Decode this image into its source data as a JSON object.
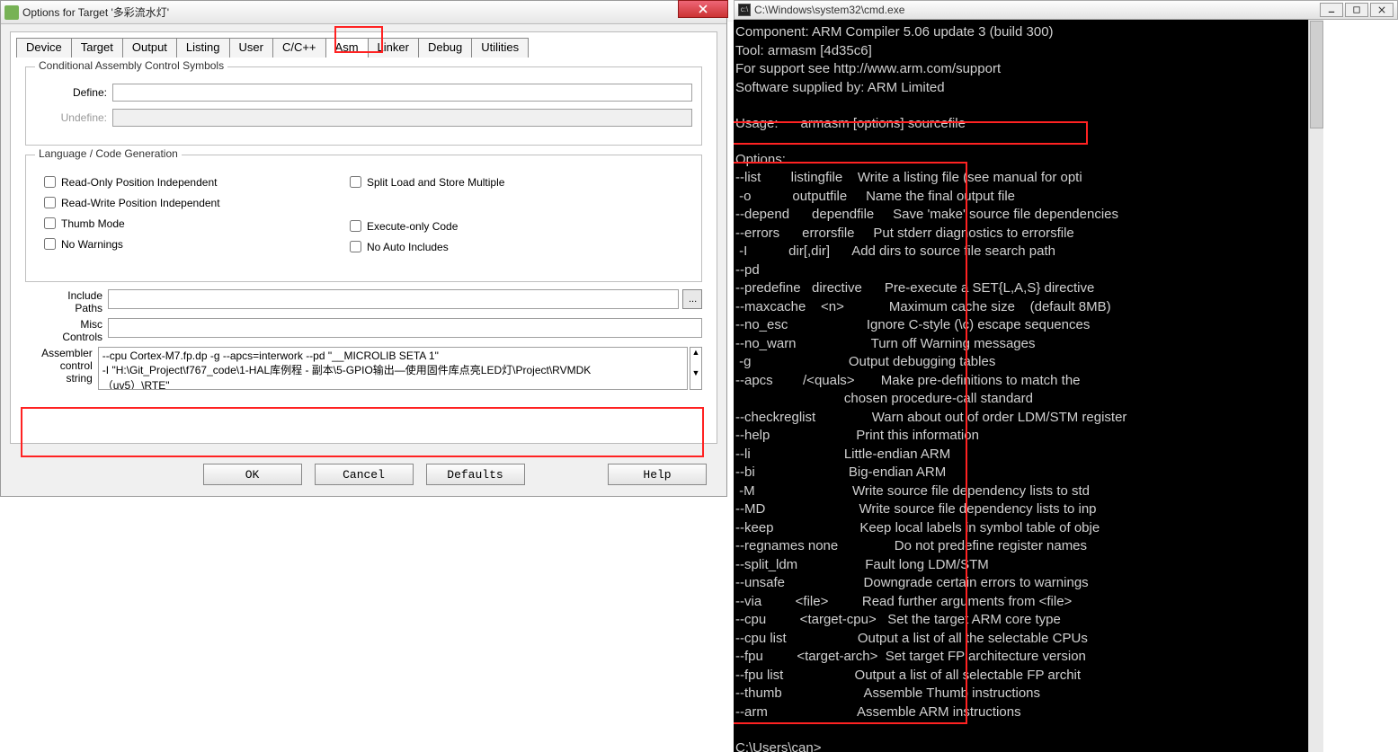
{
  "dialog": {
    "title": "Options for Target '多彩流水灯'",
    "tabs": [
      "Device",
      "Target",
      "Output",
      "Listing",
      "User",
      "C/C++",
      "Asm",
      "Linker",
      "Debug",
      "Utilities"
    ],
    "activeTab": "Asm",
    "group1": {
      "legend": "Conditional Assembly Control Symbols",
      "define_lbl": "Define:",
      "undefine_lbl": "Undefine:"
    },
    "group2": {
      "legend": "Language / Code Generation",
      "chk_ropi": "Read-Only Position Independent",
      "chk_rwpi": "Read-Write Position Independent",
      "chk_thumb": "Thumb Mode",
      "chk_nowarn": "No Warnings",
      "chk_split": "Split Load and Store Multiple",
      "chk_execonly": "Execute-only Code",
      "chk_noauto": "No Auto Includes"
    },
    "include_lbl": "Include\nPaths",
    "misc_lbl": "Misc\nControls",
    "asm_lbl": "Assembler\ncontrol\nstring",
    "asm_string": "--cpu Cortex-M7.fp.dp -g --apcs=interwork --pd \"__MICROLIB SETA 1\"\n-I \"H:\\Git_Project\\f767_code\\1-HAL库例程 - 副本\\5-GPIO输出—使用固件库点亮LED灯\\Project\\RVMDK\n（uv5）\\RTE\"",
    "btn_ok": "OK",
    "btn_cancel": "Cancel",
    "btn_defaults": "Defaults",
    "btn_help": "Help"
  },
  "cmd": {
    "title": "C:\\Windows\\system32\\cmd.exe",
    "header": "Component: ARM Compiler 5.06 update 3 (build 300)\nTool: armasm [4d35c6]\nFor support see http://www.arm.com/support\nSoftware supplied by: ARM Limited",
    "usage": "Usage:      armasm [options] sourcefile",
    "options_hdr": "Options:",
    "opts": [
      [
        "--list",
        "listingfile",
        "Write a listing file (see manual for opti"
      ],
      [
        " -o",
        "outputfile",
        "Name the final output file"
      ],
      [
        "--depend",
        "dependfile",
        "Save 'make' source file dependencies"
      ],
      [
        "--errors",
        "errorsfile",
        "Put stderr diagnostics to errorsfile"
      ],
      [
        " -I",
        "dir[,dir]",
        "Add dirs to source file search path"
      ],
      [
        "--pd",
        "",
        ""
      ],
      [
        "--predefine",
        "directive",
        "Pre-execute a SET{L,A,S} directive"
      ],
      [
        "--maxcache",
        "<n>",
        "Maximum cache size    (default 8MB)"
      ],
      [
        "--no_esc",
        "",
        "Ignore C-style (\\c) escape sequences"
      ],
      [
        "--no_warn",
        "",
        "Turn off Warning messages"
      ],
      [
        " -g",
        "",
        "Output debugging tables"
      ],
      [
        "--apcs",
        "/<quals>",
        "Make pre-definitions to match the"
      ],
      [
        "",
        "",
        "chosen procedure-call standard"
      ],
      [
        "--checkreglist",
        "",
        "Warn about out of order LDM/STM register"
      ],
      [
        "--help",
        "",
        "Print this information"
      ],
      [
        "--li",
        "",
        "Little-endian ARM"
      ],
      [
        "--bi",
        "",
        "Big-endian ARM"
      ],
      [
        " -M",
        "",
        "Write source file dependency lists to std"
      ],
      [
        "--MD",
        "",
        "Write source file dependency lists to inp"
      ],
      [
        "--keep",
        "",
        "Keep local labels in symbol table of obje"
      ],
      [
        "--regnames none",
        "",
        "Do not predefine register names"
      ],
      [
        "--split_ldm",
        "",
        "Fault long LDM/STM"
      ],
      [
        "--unsafe",
        "",
        "Downgrade certain errors to warnings"
      ],
      [
        "--via",
        "<file>",
        "Read further arguments from <file>"
      ],
      [
        "--cpu",
        "<target-cpu>",
        "Set the target ARM core type"
      ],
      [
        "--cpu list",
        "",
        "Output a list of all the selectable CPUs"
      ],
      [
        "--fpu",
        "<target-arch>",
        "Set target FP architecture version"
      ],
      [
        "--fpu list",
        "",
        "Output a list of all selectable FP archit"
      ],
      [
        "--thumb",
        "",
        "Assemble Thumb instructions"
      ],
      [
        "--arm",
        "",
        "Assemble ARM instructions"
      ]
    ],
    "prompt": "C:\\Users\\can>"
  }
}
